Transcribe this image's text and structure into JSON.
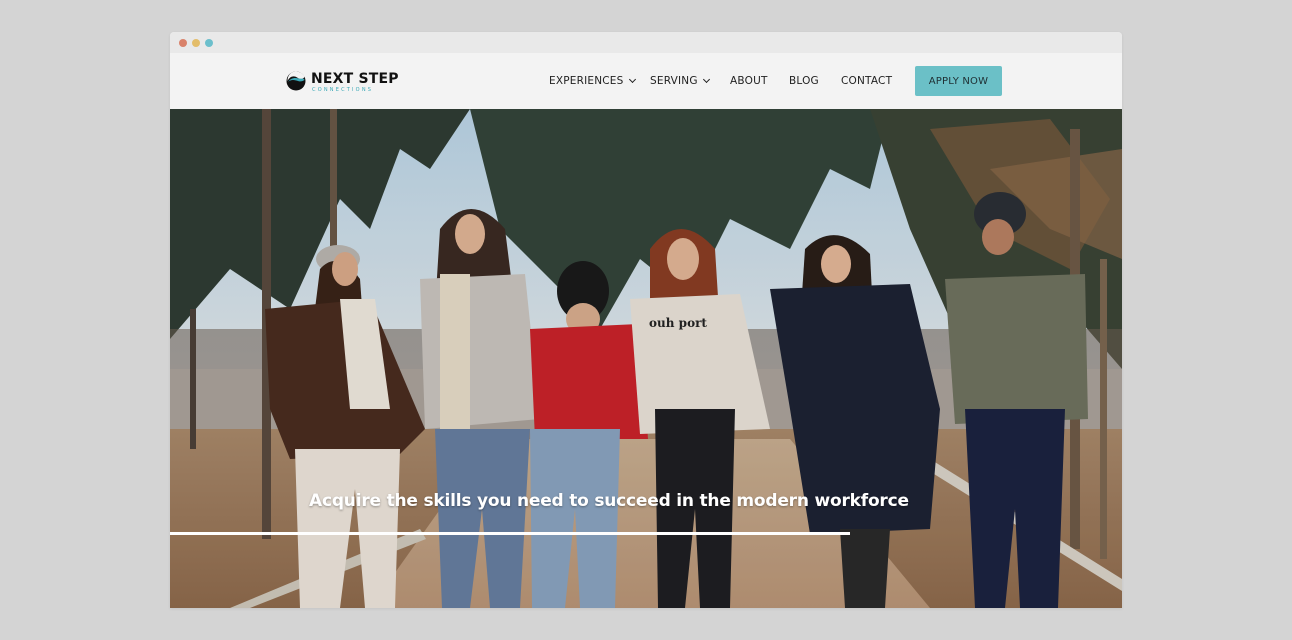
{
  "brand": {
    "name": "NEXT STEP",
    "tagline": "CONNECTIONS",
    "accent": "#6bc0c7"
  },
  "nav": {
    "items": [
      {
        "label": "EXPERIENCES",
        "has_dropdown": true
      },
      {
        "label": "SERVING",
        "has_dropdown": true
      },
      {
        "label": "ABOUT",
        "has_dropdown": false
      },
      {
        "label": "BLOG",
        "has_dropdown": false
      },
      {
        "label": "CONTACT",
        "has_dropdown": false
      }
    ],
    "cta_label": "APPLY NOW"
  },
  "hero": {
    "headline": "Acquire the skills you need to succeed in the modern workforce",
    "image_alt": "Six young women walking together holding hands on a path through a winter park",
    "sweater_text": "ouh port"
  }
}
